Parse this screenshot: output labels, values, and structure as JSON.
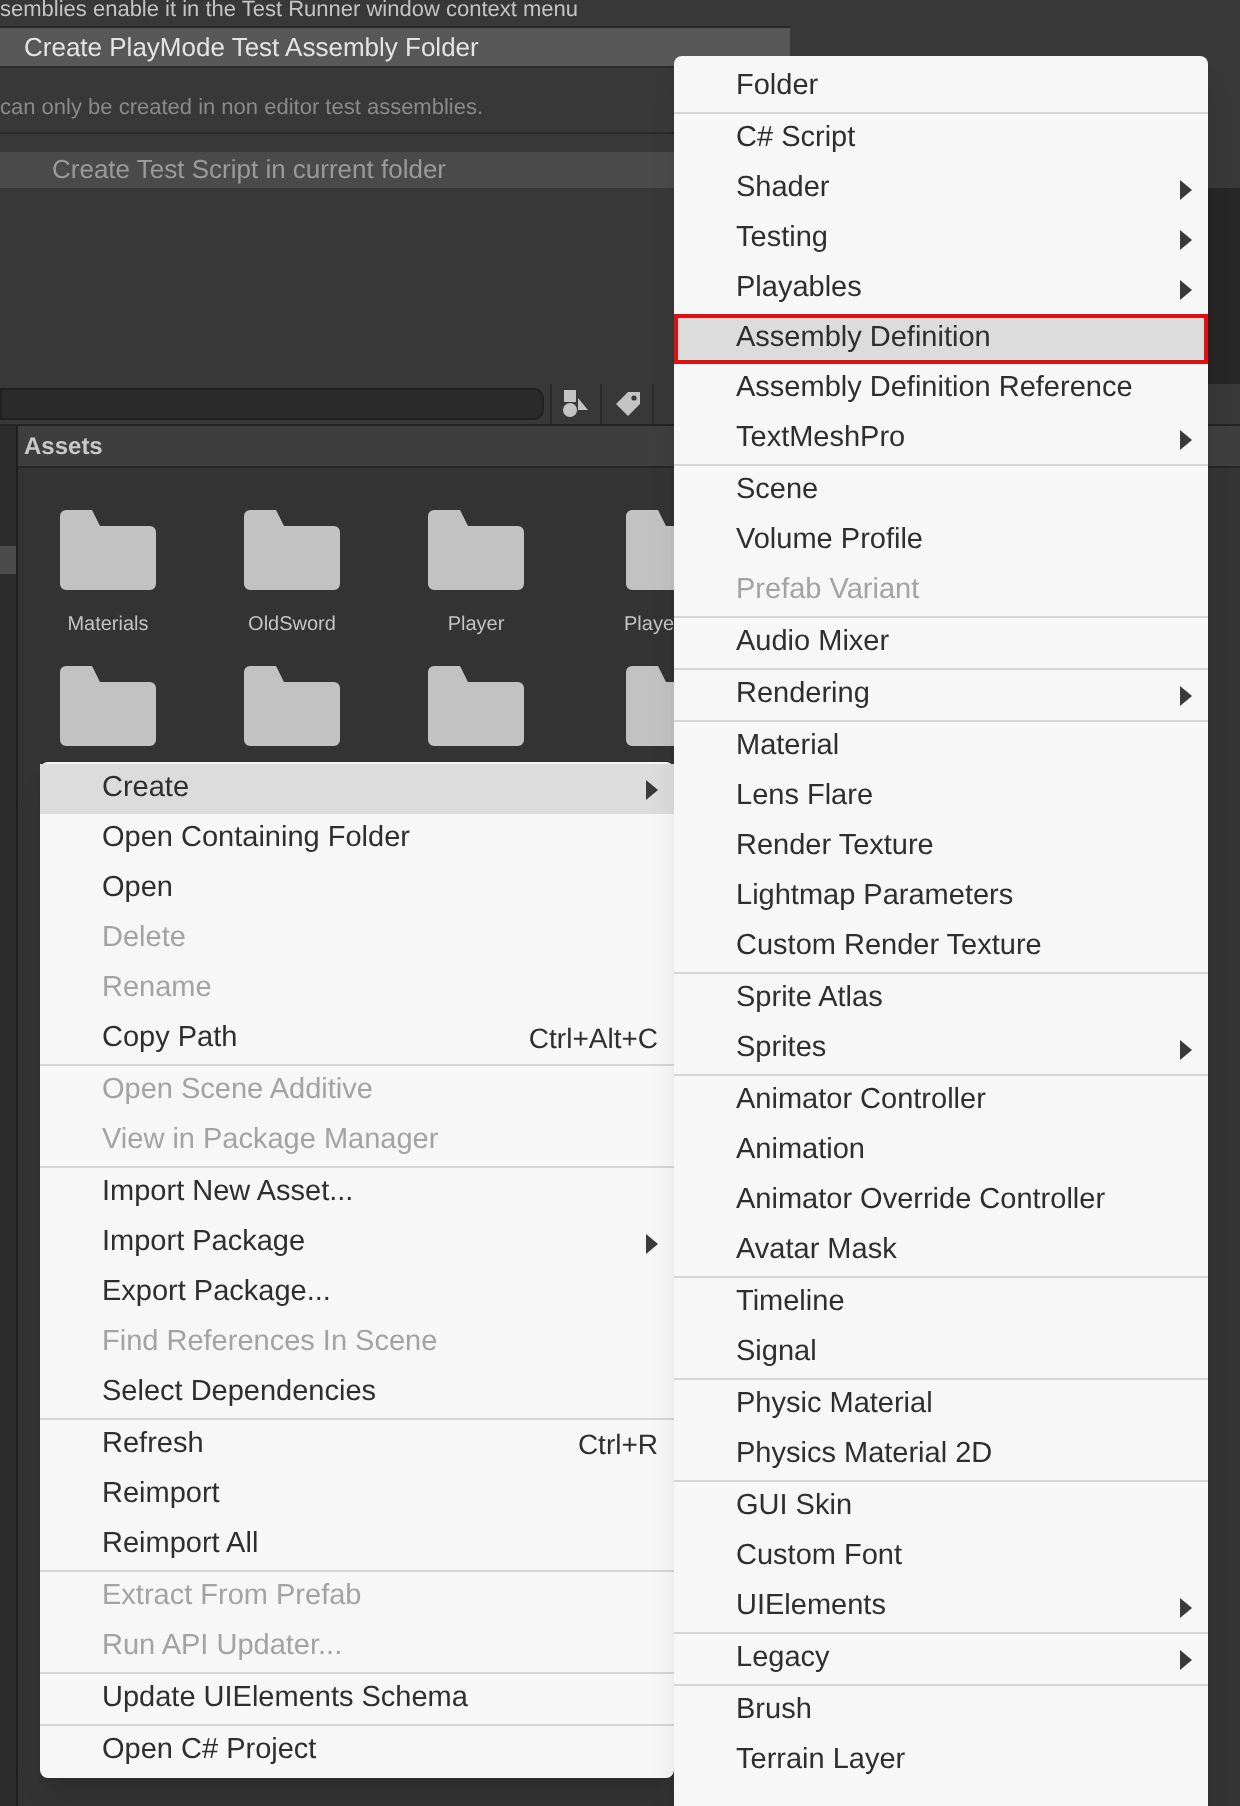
{
  "inspector": {
    "hint": "semblies enable it in the Test Runner window context menu",
    "playmode_button": "Create PlayMode Test Assembly Folder",
    "note": "can only be created in non editor test assemblies.",
    "script_button": {
      "label": "Create Test Script in current folder",
      "disabled": true
    }
  },
  "project": {
    "header": "Assets",
    "folders": [
      {
        "kind": "folder",
        "label": "Materials"
      },
      {
        "kind": "folder",
        "label": "OldSword"
      },
      {
        "kind": "folder",
        "label": "Player"
      },
      {
        "kind": "edge_folder",
        "label": "Playe"
      },
      {
        "kind": "folder"
      },
      {
        "kind": "folder"
      },
      {
        "kind": "folder"
      },
      {
        "kind": "edge_folder"
      }
    ]
  },
  "context_menu": {
    "groups": [
      [
        {
          "label": "Create",
          "submenu": true,
          "disabled": false,
          "selected": true
        },
        {
          "label": "Open Containing Folder",
          "submenu": false,
          "disabled": false,
          "selected": false
        },
        {
          "label": "Open",
          "submenu": false,
          "disabled": false,
          "selected": false
        },
        {
          "label": "Delete",
          "submenu": false,
          "disabled": true,
          "selected": false
        },
        {
          "label": "Rename",
          "submenu": false,
          "disabled": true,
          "selected": false
        },
        {
          "label": "Copy Path",
          "shortcut": "Ctrl+Alt+C",
          "submenu": false,
          "disabled": false,
          "selected": false
        }
      ],
      [
        {
          "label": "Open Scene Additive",
          "submenu": false,
          "disabled": true,
          "selected": false
        },
        {
          "label": "View in Package Manager",
          "submenu": false,
          "disabled": true,
          "selected": false
        }
      ],
      [
        {
          "label": "Import New Asset...",
          "submenu": false,
          "disabled": false,
          "selected": false
        },
        {
          "label": "Import Package",
          "submenu": true,
          "disabled": false,
          "selected": false
        },
        {
          "label": "Export Package...",
          "submenu": false,
          "disabled": false,
          "selected": false
        },
        {
          "label": "Find References In Scene",
          "submenu": false,
          "disabled": true,
          "selected": false
        },
        {
          "label": "Select Dependencies",
          "submenu": false,
          "disabled": false,
          "selected": false
        }
      ],
      [
        {
          "label": "Refresh",
          "shortcut": "Ctrl+R",
          "submenu": false,
          "disabled": false,
          "selected": false
        },
        {
          "label": "Reimport",
          "submenu": false,
          "disabled": false,
          "selected": false
        },
        {
          "label": "Reimport All",
          "submenu": false,
          "disabled": false,
          "selected": false
        }
      ],
      [
        {
          "label": "Extract From Prefab",
          "submenu": false,
          "disabled": true,
          "selected": false
        },
        {
          "label": "Run API Updater...",
          "submenu": false,
          "disabled": true,
          "selected": false
        }
      ],
      [
        {
          "label": "Update UIElements Schema",
          "submenu": false,
          "disabled": false,
          "selected": false
        }
      ],
      [
        {
          "label": "Open C# Project",
          "submenu": false,
          "disabled": false,
          "selected": false
        }
      ]
    ]
  },
  "create_submenu": {
    "groups": [
      [
        {
          "label": "Folder",
          "submenu": false,
          "disabled": false,
          "selected": false
        }
      ],
      [
        {
          "label": "C# Script",
          "submenu": false,
          "disabled": false,
          "selected": false
        },
        {
          "label": "Shader",
          "submenu": true,
          "disabled": false,
          "selected": false
        },
        {
          "label": "Testing",
          "submenu": true,
          "disabled": false,
          "selected": false
        },
        {
          "label": "Playables",
          "submenu": true,
          "disabled": false,
          "selected": false
        },
        {
          "label": "Assembly Definition",
          "submenu": false,
          "disabled": false,
          "selected": true
        },
        {
          "label": "Assembly Definition Reference",
          "submenu": false,
          "disabled": false,
          "selected": false
        },
        {
          "label": "TextMeshPro",
          "submenu": true,
          "disabled": false,
          "selected": false
        }
      ],
      [
        {
          "label": "Scene",
          "submenu": false,
          "disabled": false,
          "selected": false
        },
        {
          "label": "Volume Profile",
          "submenu": false,
          "disabled": false,
          "selected": false
        },
        {
          "label": "Prefab Variant",
          "submenu": false,
          "disabled": true,
          "selected": false
        }
      ],
      [
        {
          "label": "Audio Mixer",
          "submenu": false,
          "disabled": false,
          "selected": false
        }
      ],
      [
        {
          "label": "Rendering",
          "submenu": true,
          "disabled": false,
          "selected": false
        }
      ],
      [
        {
          "label": "Material",
          "submenu": false,
          "disabled": false,
          "selected": false
        },
        {
          "label": "Lens Flare",
          "submenu": false,
          "disabled": false,
          "selected": false
        },
        {
          "label": "Render Texture",
          "submenu": false,
          "disabled": false,
          "selected": false
        },
        {
          "label": "Lightmap Parameters",
          "submenu": false,
          "disabled": false,
          "selected": false
        },
        {
          "label": "Custom Render Texture",
          "submenu": false,
          "disabled": false,
          "selected": false
        }
      ],
      [
        {
          "label": "Sprite Atlas",
          "submenu": false,
          "disabled": false,
          "selected": false
        },
        {
          "label": "Sprites",
          "submenu": true,
          "disabled": false,
          "selected": false
        }
      ],
      [
        {
          "label": "Animator Controller",
          "submenu": false,
          "disabled": false,
          "selected": false
        },
        {
          "label": "Animation",
          "submenu": false,
          "disabled": false,
          "selected": false
        },
        {
          "label": "Animator Override Controller",
          "submenu": false,
          "disabled": false,
          "selected": false
        },
        {
          "label": "Avatar Mask",
          "submenu": false,
          "disabled": false,
          "selected": false
        }
      ],
      [
        {
          "label": "Timeline",
          "submenu": false,
          "disabled": false,
          "selected": false
        },
        {
          "label": "Signal",
          "submenu": false,
          "disabled": false,
          "selected": false
        }
      ],
      [
        {
          "label": "Physic Material",
          "submenu": false,
          "disabled": false,
          "selected": false
        },
        {
          "label": "Physics Material 2D",
          "submenu": false,
          "disabled": false,
          "selected": false
        }
      ],
      [
        {
          "label": "GUI Skin",
          "submenu": false,
          "disabled": false,
          "selected": false
        },
        {
          "label": "Custom Font",
          "submenu": false,
          "disabled": false,
          "selected": false
        },
        {
          "label": "UIElements",
          "submenu": true,
          "disabled": false,
          "selected": false
        }
      ],
      [
        {
          "label": "Legacy",
          "submenu": true,
          "disabled": false,
          "selected": false
        }
      ],
      [
        {
          "label": "Brush",
          "submenu": false,
          "disabled": false,
          "selected": false
        },
        {
          "label": "Terrain Layer",
          "submenu": false,
          "disabled": false,
          "selected": false
        }
      ]
    ]
  }
}
